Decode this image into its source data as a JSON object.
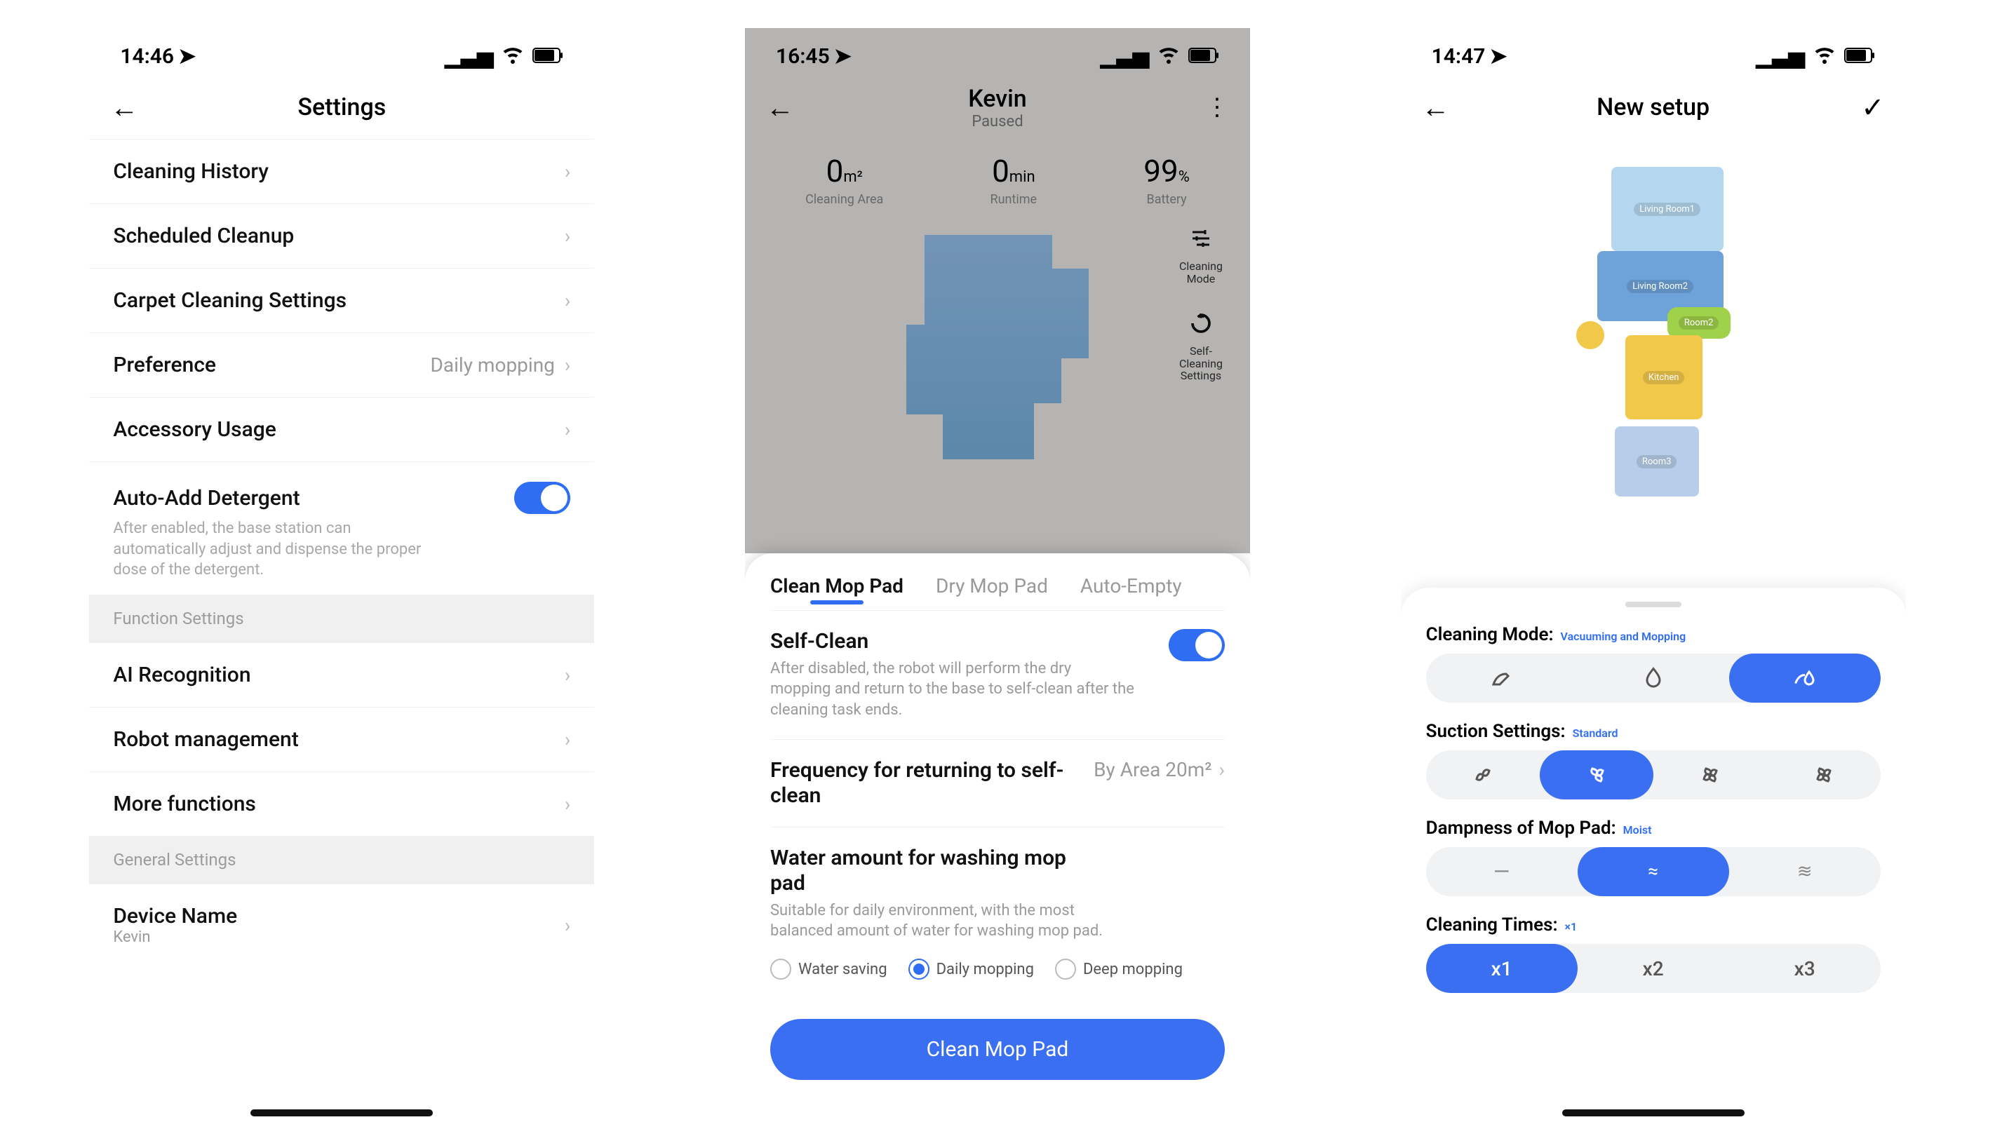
{
  "screen1": {
    "status_time": "14:46",
    "title": "Settings",
    "rows": {
      "history": "Cleaning History",
      "scheduled": "Scheduled Cleanup",
      "carpet": "Carpet Cleaning Settings",
      "preference": "Preference",
      "preference_value": "Daily mopping",
      "accessory": "Accessory Usage",
      "detergent": "Auto-Add Detergent",
      "detergent_desc": "After enabled, the base station can automatically adjust and dispense the proper dose of the detergent.",
      "section_function": "Function Settings",
      "ai": "AI Recognition",
      "robot_mgmt": "Robot management",
      "more_fn": "More functions",
      "section_general": "General Settings",
      "device_name": "Device Name",
      "device_name_value": "Kevin"
    }
  },
  "screen2": {
    "status_time": "16:45",
    "device": "Kevin",
    "device_state": "Paused",
    "stats": {
      "area_val": "0",
      "area_unit": "m²",
      "area_lbl": "Cleaning Area",
      "runtime_val": "0",
      "runtime_unit": "min",
      "runtime_lbl": "Runtime",
      "battery_val": "99",
      "battery_unit": "%",
      "battery_lbl": "Battery"
    },
    "side": {
      "mode": "Cleaning Mode",
      "selfclean": "Self-Cleaning Settings"
    },
    "tabs": {
      "a": "Clean Mop Pad",
      "b": "Dry Mop Pad",
      "c": "Auto-Empty"
    },
    "selfclean_title": "Self-Clean",
    "selfclean_desc": "After disabled, the robot will perform the dry mopping and return to the base to self-clean after the cleaning task ends.",
    "freq_title": "Frequency for returning to self-clean",
    "freq_value": "By Area 20m²",
    "water_title": "Water amount for washing mop pad",
    "water_desc": "Suitable for daily environment, with the most balanced amount of water for washing mop pad.",
    "water_opts": {
      "a": "Water saving",
      "b": "Daily mopping",
      "c": "Deep mopping"
    },
    "cta": "Clean Mop Pad"
  },
  "screen3": {
    "status_time": "14:47",
    "title": "New setup",
    "rooms": {
      "living1": "Living Room1",
      "living2": "Living Room2",
      "room2": "Room2",
      "kitchen": "Kitchen",
      "room3": "Room3"
    },
    "mode_label": "Cleaning Mode:",
    "mode_value": "Vacuuming and Mopping",
    "suction_label": "Suction Settings:",
    "suction_value": "Standard",
    "damp_label": "Dampness of Mop Pad:",
    "damp_value": "Moist",
    "times_label": "Cleaning Times:",
    "times_value": "×1",
    "times_opts": {
      "a": "x1",
      "b": "x2",
      "c": "x3"
    }
  }
}
